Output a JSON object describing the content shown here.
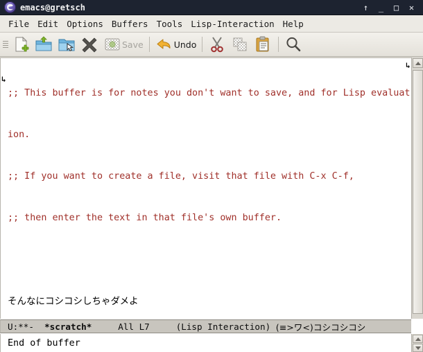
{
  "window": {
    "title": "emacs@gretsch",
    "app_icon": "emacs-icon",
    "controls": [
      {
        "name": "shade-button",
        "glyph": "↑"
      },
      {
        "name": "minimize-button",
        "glyph": "_"
      },
      {
        "name": "maximize-button",
        "glyph": "□"
      },
      {
        "name": "close-button",
        "glyph": "✕"
      }
    ],
    "titlebar_bg": "#1d2330",
    "titlebar_fg": "#f2f2f2"
  },
  "menubar": {
    "items": [
      {
        "label": "File",
        "name": "menu-file"
      },
      {
        "label": "Edit",
        "name": "menu-edit"
      },
      {
        "label": "Options",
        "name": "menu-options"
      },
      {
        "label": "Buffers",
        "name": "menu-buffers"
      },
      {
        "label": "Tools",
        "name": "menu-tools"
      },
      {
        "label": "Lisp-Interaction",
        "name": "menu-lisp-interaction"
      },
      {
        "label": "Help",
        "name": "menu-help"
      }
    ]
  },
  "toolbar": {
    "grip": "toolbar-grip",
    "buttons": [
      {
        "name": "new-file-button",
        "icon": "new-file-icon",
        "label": "",
        "disabled": false
      },
      {
        "name": "open-file-button",
        "icon": "open-file-icon",
        "label": "",
        "disabled": false
      },
      {
        "name": "open-dir-button",
        "icon": "open-dir-icon",
        "label": "",
        "disabled": false
      },
      {
        "name": "close-buffer-button",
        "icon": "close-x-icon",
        "label": "",
        "disabled": false
      },
      {
        "name": "save-button",
        "icon": "save-icon",
        "label": "Save",
        "disabled": true
      },
      {
        "name": "undo-button",
        "icon": "undo-icon",
        "label": "Undo",
        "disabled": false
      },
      {
        "name": "cut-button",
        "icon": "scissors-icon",
        "label": "",
        "disabled": false
      },
      {
        "name": "copy-button",
        "icon": "copy-icon",
        "label": "",
        "disabled": true
      },
      {
        "name": "paste-button",
        "icon": "clipboard-icon",
        "label": "",
        "disabled": false
      },
      {
        "name": "search-button",
        "icon": "search-icon",
        "label": "",
        "disabled": false
      }
    ]
  },
  "buffer": {
    "name": "*scratch*",
    "lines": [
      {
        "text": ";; This buffer is for notes you don't want to save, and for Lisp evaluat",
        "style": "comment"
      },
      {
        "text": "ion.",
        "style": "comment"
      },
      {
        "text": ";; If you want to create a file, visit that file with C-x C-f,",
        "style": "comment"
      },
      {
        "text": ";; then enter the text in that file's own buffer.",
        "style": "comment"
      },
      {
        "text": "",
        "style": "plain"
      },
      {
        "text": "そんなにコシコシしちゃダメよ",
        "style": "jp"
      }
    ],
    "wrap_indicator": "↳",
    "comment_color": "#a0302a",
    "text_color": "#000000",
    "background": "#ffffff"
  },
  "modeline": {
    "status": "U:**-",
    "buffer_name": "*scratch*",
    "position": "All L7",
    "major_mode": "(Lisp Interaction)",
    "extra": "(≡>ワ<)コシコシコシ",
    "background": "#c8c5be"
  },
  "minibuffer": {
    "message": "End of buffer"
  },
  "scrollbar": {
    "up_arrow": "scroll-up-arrow",
    "down_arrow": "scroll-down-arrow",
    "thumb": "scroll-thumb"
  }
}
